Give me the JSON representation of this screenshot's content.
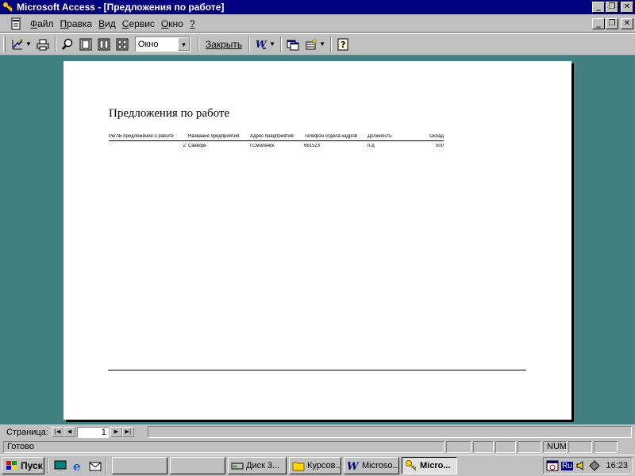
{
  "window": {
    "title": "Microsoft Access - [Предложения по работе]"
  },
  "menu": {
    "items": [
      {
        "ul": "Ф",
        "rest": "айл"
      },
      {
        "ul": "П",
        "rest": "равка"
      },
      {
        "ul": "В",
        "rest": "ид"
      },
      {
        "ul": "С",
        "rest": "ервис"
      },
      {
        "ul": "О",
        "rest": "кно"
      },
      {
        "ul": "?",
        "rest": ""
      }
    ]
  },
  "toolbar": {
    "zoom_value": "Окно",
    "close_label": "Закрыть"
  },
  "report": {
    "title": "Предложения по работе",
    "columns": [
      "Рег.№ предложения о работе",
      "Название предприятия",
      "Адрес предприятия",
      "Телефон отдела кадров",
      "Должность",
      "Оклад"
    ],
    "rows": [
      [
        "2",
        "Сакворк",
        "г.Смоленск",
        "661523",
        "п-д",
        "500"
      ]
    ]
  },
  "navigation": {
    "label": "Страница:",
    "page": "1"
  },
  "status": {
    "text": "Готово",
    "num": "NUM"
  },
  "taskbar": {
    "start_label": "Пуск",
    "tasks": [
      {
        "label": "",
        "icon": "blank"
      },
      {
        "label": "",
        "icon": "blank"
      },
      {
        "label": "Диск 3...",
        "icon": "drive-icon"
      },
      {
        "label": "Курсов...",
        "icon": "folder-icon"
      },
      {
        "label": "Microso...",
        "icon": "word-icon"
      },
      {
        "label": "Micro...",
        "icon": "access-key-icon",
        "active": true
      }
    ],
    "tray_lang": "Ru",
    "clock": "16:23"
  },
  "colors": {
    "titlebar": "#000080",
    "workspace": "#408080",
    "chrome": "#c0c0c0"
  }
}
